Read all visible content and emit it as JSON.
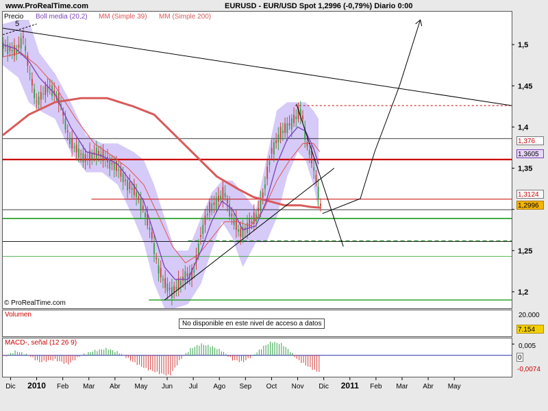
{
  "header": {
    "brand": "www.ProRealTime.com",
    "title": "EURUSD - EUR/USD Spot    1,2996 (-0,79%)    Diario  0:00"
  },
  "price_panel": {
    "legend": {
      "price": "Precio",
      "boll": "Boll media (20,2)",
      "mm39": "MM (Simple 39)",
      "mm200": "MM (Simple 200)"
    },
    "wave_label": "5",
    "watermark": "© ProRealTime.com",
    "tags": [
      "1,376",
      "1,3605",
      "1,3124",
      "1,2996"
    ]
  },
  "volume_panel": {
    "label": "Volumen",
    "message": "No disponible en este nivel de acceso a datos",
    "tick": "20.000",
    "tag": "7.154"
  },
  "macd_panel": {
    "label": "MACD-, señal (12 26 9)",
    "ticks": [
      "0,005",
      "0"
    ],
    "tag": "-0,0074"
  },
  "colors": {
    "boll": "#7b3fb8",
    "mm39": "#e05050",
    "mm200": "#d85a5a",
    "band": "#c8b8f5",
    "up": "#2ea043",
    "down": "#d23c3c"
  },
  "chart_data": {
    "type": "line",
    "series_name": "EUR/USD",
    "y_range": [
      1.18,
      1.54
    ],
    "y_ticks": [
      1.2,
      1.25,
      1.3,
      1.35,
      1.4,
      1.45,
      1.5
    ],
    "y_tick_labels": [
      "1,2",
      "1,25",
      "",
      "1,35",
      "1,4",
      "1,45",
      "1,5"
    ],
    "x_range": [
      0,
      19.5
    ],
    "x_ticks": [
      {
        "m": 0.3,
        "label": "Dic"
      },
      {
        "m": 1.3,
        "label": "2010"
      },
      {
        "m": 2.3,
        "label": "Feb"
      },
      {
        "m": 3.3,
        "label": "Mar"
      },
      {
        "m": 4.3,
        "label": "Abr"
      },
      {
        "m": 5.3,
        "label": "May"
      },
      {
        "m": 6.3,
        "label": "Jun"
      },
      {
        "m": 7.3,
        "label": "Jul"
      },
      {
        "m": 8.3,
        "label": "Ago"
      },
      {
        "m": 9.3,
        "label": "Sep"
      },
      {
        "m": 10.3,
        "label": "Oct"
      },
      {
        "m": 11.3,
        "label": "Nov"
      },
      {
        "m": 12.3,
        "label": "Dic"
      },
      {
        "m": 13.3,
        "label": "2011"
      },
      {
        "m": 14.3,
        "label": "Feb"
      },
      {
        "m": 15.3,
        "label": "Mar"
      },
      {
        "m": 16.3,
        "label": "Abr"
      },
      {
        "m": 17.3,
        "label": "May"
      }
    ],
    "price": [
      [
        0,
        1.5
      ],
      [
        0.5,
        1.49
      ],
      [
        0.8,
        1.51
      ],
      [
        1.0,
        1.47
      ],
      [
        1.3,
        1.43
      ],
      [
        1.8,
        1.45
      ],
      [
        2.2,
        1.43
      ],
      [
        2.6,
        1.38
      ],
      [
        3.2,
        1.36
      ],
      [
        3.6,
        1.37
      ],
      [
        4.0,
        1.36
      ],
      [
        4.4,
        1.35
      ],
      [
        4.8,
        1.33
      ],
      [
        5.1,
        1.32
      ],
      [
        5.4,
        1.3
      ],
      [
        5.7,
        1.27
      ],
      [
        5.95,
        1.23
      ],
      [
        6.2,
        1.21
      ],
      [
        6.5,
        1.2
      ],
      [
        6.8,
        1.21
      ],
      [
        7.0,
        1.22
      ],
      [
        7.3,
        1.22
      ],
      [
        7.6,
        1.27
      ],
      [
        7.9,
        1.3
      ],
      [
        8.2,
        1.31
      ],
      [
        8.5,
        1.32
      ],
      [
        8.8,
        1.29
      ],
      [
        9.1,
        1.27
      ],
      [
        9.4,
        1.28
      ],
      [
        9.7,
        1.29
      ],
      [
        10.0,
        1.32
      ],
      [
        10.3,
        1.37
      ],
      [
        10.6,
        1.39
      ],
      [
        10.9,
        1.4
      ],
      [
        11.2,
        1.41
      ],
      [
        11.45,
        1.42
      ],
      [
        11.65,
        1.38
      ],
      [
        11.85,
        1.36
      ],
      [
        12.05,
        1.33
      ],
      [
        12.2,
        1.3
      ]
    ],
    "boll_media": [
      [
        0,
        1.5
      ],
      [
        0.5,
        1.495
      ],
      [
        1.0,
        1.48
      ],
      [
        1.4,
        1.46
      ],
      [
        2.0,
        1.44
      ],
      [
        2.6,
        1.4
      ],
      [
        3.2,
        1.37
      ],
      [
        3.8,
        1.365
      ],
      [
        4.4,
        1.355
      ],
      [
        5.0,
        1.33
      ],
      [
        5.4,
        1.31
      ],
      [
        5.8,
        1.27
      ],
      [
        6.2,
        1.23
      ],
      [
        6.6,
        1.215
      ],
      [
        7.1,
        1.215
      ],
      [
        7.6,
        1.25
      ],
      [
        8.0,
        1.285
      ],
      [
        8.4,
        1.31
      ],
      [
        8.8,
        1.3
      ],
      [
        9.2,
        1.275
      ],
      [
        9.7,
        1.28
      ],
      [
        10.1,
        1.31
      ],
      [
        10.5,
        1.355
      ],
      [
        10.9,
        1.385
      ],
      [
        11.3,
        1.4
      ],
      [
        11.6,
        1.395
      ],
      [
        11.9,
        1.375
      ],
      [
        12.1,
        1.355
      ]
    ],
    "mm39": [
      [
        0,
        1.485
      ],
      [
        0.7,
        1.49
      ],
      [
        1.3,
        1.475
      ],
      [
        2.0,
        1.45
      ],
      [
        2.8,
        1.41
      ],
      [
        3.5,
        1.38
      ],
      [
        4.2,
        1.365
      ],
      [
        4.8,
        1.35
      ],
      [
        5.4,
        1.33
      ],
      [
        6.0,
        1.29
      ],
      [
        6.5,
        1.255
      ],
      [
        7.0,
        1.235
      ],
      [
        7.5,
        1.245
      ],
      [
        8.0,
        1.265
      ],
      [
        8.5,
        1.285
      ],
      [
        9.0,
        1.285
      ],
      [
        9.5,
        1.28
      ],
      [
        10.0,
        1.3
      ],
      [
        10.5,
        1.335
      ],
      [
        11.0,
        1.36
      ],
      [
        11.5,
        1.38
      ],
      [
        11.9,
        1.38
      ],
      [
        12.15,
        1.37
      ]
    ],
    "mm200": [
      [
        0,
        1.39
      ],
      [
        1.0,
        1.415
      ],
      [
        2.0,
        1.43
      ],
      [
        3.0,
        1.435
      ],
      [
        4.0,
        1.435
      ],
      [
        5.0,
        1.425
      ],
      [
        5.8,
        1.415
      ],
      [
        6.6,
        1.39
      ],
      [
        7.4,
        1.365
      ],
      [
        8.2,
        1.34
      ],
      [
        9.0,
        1.325
      ],
      [
        9.6,
        1.315
      ],
      [
        10.2,
        1.31
      ],
      [
        10.8,
        1.305
      ],
      [
        11.4,
        1.305
      ],
      [
        11.8,
        1.303
      ],
      [
        12.2,
        1.302
      ]
    ],
    "band_upper": [
      [
        0,
        1.525
      ],
      [
        0.6,
        1.53
      ],
      [
        1.0,
        1.53
      ],
      [
        1.4,
        1.49
      ],
      [
        2.0,
        1.465
      ],
      [
        2.6,
        1.43
      ],
      [
        3.2,
        1.39
      ],
      [
        3.8,
        1.38
      ],
      [
        4.4,
        1.38
      ],
      [
        5.0,
        1.37
      ],
      [
        5.4,
        1.36
      ],
      [
        5.8,
        1.33
      ],
      [
        6.2,
        1.29
      ],
      [
        6.6,
        1.25
      ],
      [
        7.1,
        1.25
      ],
      [
        7.6,
        1.29
      ],
      [
        8.0,
        1.32
      ],
      [
        8.4,
        1.335
      ],
      [
        8.8,
        1.335
      ],
      [
        9.2,
        1.32
      ],
      [
        9.7,
        1.3
      ],
      [
        10.1,
        1.36
      ],
      [
        10.5,
        1.42
      ],
      [
        10.9,
        1.43
      ],
      [
        11.3,
        1.43
      ],
      [
        11.6,
        1.43
      ],
      [
        11.9,
        1.42
      ],
      [
        12.1,
        1.41
      ]
    ],
    "band_lower": [
      [
        0,
        1.475
      ],
      [
        0.6,
        1.46
      ],
      [
        1.0,
        1.43
      ],
      [
        1.4,
        1.42
      ],
      [
        2.0,
        1.41
      ],
      [
        2.6,
        1.37
      ],
      [
        3.2,
        1.345
      ],
      [
        3.8,
        1.345
      ],
      [
        4.4,
        1.33
      ],
      [
        5.0,
        1.29
      ],
      [
        5.4,
        1.26
      ],
      [
        5.8,
        1.21
      ],
      [
        6.2,
        1.18
      ],
      [
        6.6,
        1.18
      ],
      [
        7.1,
        1.185
      ],
      [
        7.6,
        1.21
      ],
      [
        8.0,
        1.25
      ],
      [
        8.4,
        1.285
      ],
      [
        8.8,
        1.265
      ],
      [
        9.2,
        1.23
      ],
      [
        9.7,
        1.26
      ],
      [
        10.1,
        1.26
      ],
      [
        10.5,
        1.29
      ],
      [
        10.9,
        1.34
      ],
      [
        11.3,
        1.37
      ],
      [
        11.6,
        1.36
      ],
      [
        11.9,
        1.33
      ],
      [
        12.1,
        1.3
      ]
    ],
    "h_levels": [
      {
        "y": 1.3605,
        "color": "#cc0000",
        "width": 2.2,
        "dash": "",
        "from": 0
      },
      {
        "y": 1.3124,
        "color": "#cc0000",
        "width": 1,
        "dash": "",
        "from": 3.4
      },
      {
        "y": 1.386,
        "color": "#000000",
        "width": 0.8,
        "dash": "",
        "from": 0
      },
      {
        "y": 1.2996,
        "color": "#000000",
        "width": 0.8,
        "dash": "",
        "from": 0
      },
      {
        "y": 1.289,
        "color": "#1a9a1a",
        "width": 1.6,
        "dash": "",
        "from": 0
      },
      {
        "y": 1.261,
        "color": "#000000",
        "width": 0.8,
        "dash": "",
        "from": 0
      },
      {
        "y": 1.262,
        "color": "#1a9a1a",
        "width": 1,
        "dash": "6,4",
        "from": 7.1
      },
      {
        "y": 1.243,
        "color": "#1a9a1a",
        "width": 0.8,
        "dash": "",
        "from": 0
      },
      {
        "y": 1.19,
        "color": "#1a9a1a",
        "width": 1.4,
        "dash": "",
        "from": 5.6
      },
      {
        "y": 1.426,
        "color": "#cc0000",
        "width": 1,
        "dash": "3,3",
        "from": 11.2
      }
    ],
    "trend_lines": [
      [
        [
          0,
          1.52
        ],
        [
          19.5,
          1.426
        ]
      ],
      [
        [
          6.2,
          1.19
        ],
        [
          12.7,
          1.35
        ]
      ],
      [
        [
          11.25,
          1.428
        ],
        [
          13.05,
          1.255
        ]
      ],
      [
        [
          12.25,
          1.295
        ],
        [
          13.7,
          1.313
        ],
        [
          14.25,
          1.37
        ],
        [
          15.2,
          1.45
        ],
        [
          16.0,
          1.53
        ]
      ],
      [
        [
          0,
          1.512
        ],
        [
          1.3,
          1.525
        ]
      ]
    ],
    "arrow": [
      [
        16.35,
        1.525
      ],
      [
        16.4,
        1.535
      ]
    ],
    "macd": [
      [
        0,
        -0.001
      ],
      [
        0.5,
        0.002
      ],
      [
        1.0,
        0.0
      ],
      [
        1.4,
        -0.003
      ],
      [
        2.0,
        -0.002
      ],
      [
        2.5,
        -0.004
      ],
      [
        3.0,
        0.0
      ],
      [
        3.5,
        0.002
      ],
      [
        4.0,
        0.003
      ],
      [
        4.5,
        0.001
      ],
      [
        5.0,
        -0.003
      ],
      [
        5.5,
        -0.006
      ],
      [
        6.0,
        -0.008
      ],
      [
        6.4,
        -0.009
      ],
      [
        6.8,
        -0.002
      ],
      [
        7.2,
        0.003
      ],
      [
        7.6,
        0.005
      ],
      [
        8.0,
        0.004
      ],
      [
        8.4,
        0.002
      ],
      [
        8.8,
        -0.002
      ],
      [
        9.2,
        -0.003
      ],
      [
        9.6,
        0.0
      ],
      [
        10.0,
        0.004
      ],
      [
        10.3,
        0.006
      ],
      [
        10.7,
        0.005
      ],
      [
        11.0,
        0.002
      ],
      [
        11.3,
        -0.002
      ],
      [
        11.7,
        -0.005
      ],
      [
        12.0,
        -0.007
      ],
      [
        12.2,
        -0.0074
      ]
    ],
    "macd_range": [
      -0.0095,
      0.0075
    ]
  }
}
